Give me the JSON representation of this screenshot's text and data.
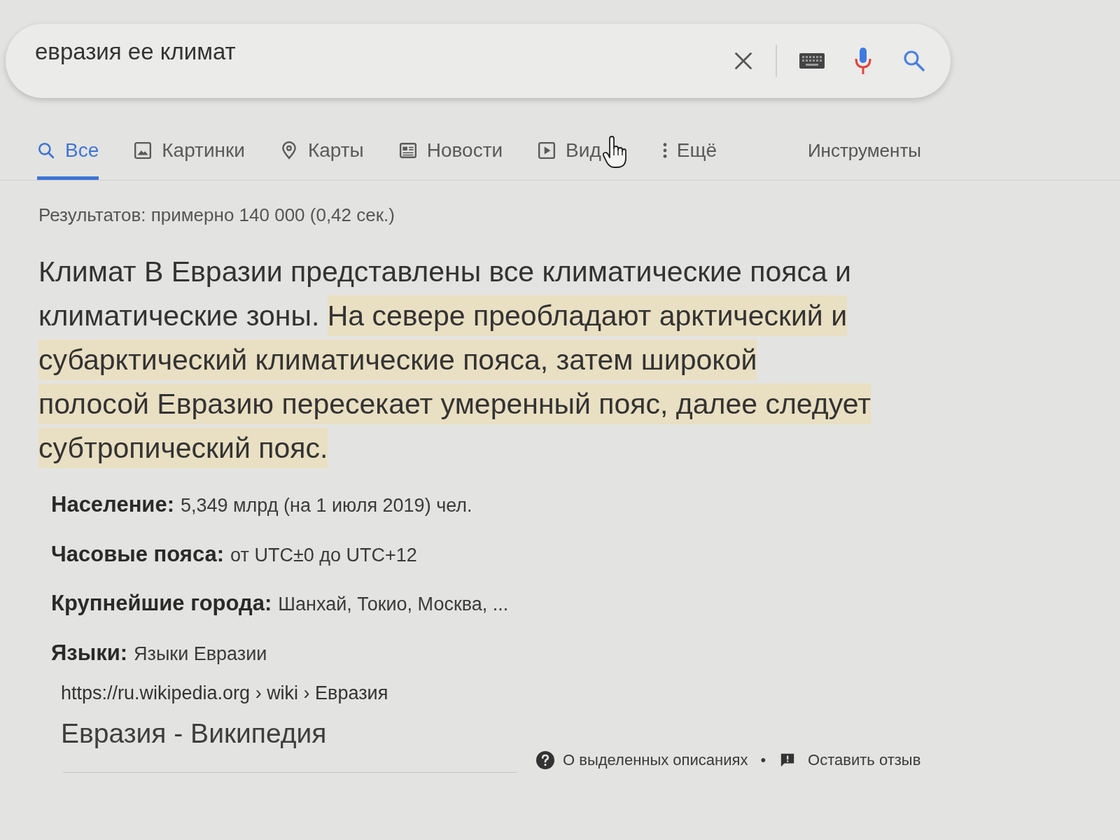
{
  "search": {
    "value": "евразия ее климат"
  },
  "tabs": [
    {
      "kind": "all",
      "label": "Все",
      "selected": true
    },
    {
      "kind": "images",
      "label": "Картинки",
      "selected": false
    },
    {
      "kind": "maps",
      "label": "Карты",
      "selected": false
    },
    {
      "kind": "news",
      "label": "Новости",
      "selected": false
    },
    {
      "kind": "video",
      "label": "Вид",
      "selected": false
    },
    {
      "kind": "more",
      "label": "Ещё",
      "selected": false
    }
  ],
  "tools": "Инструменты",
  "result_stats": "Результатов: примерно 140 000 (0,42 сек.)",
  "featured_snippet": {
    "segments": [
      {
        "text": "Климат В Евразии представлены все климатические пояса и климатические зоны. ",
        "highlighted": false
      },
      {
        "text": "На севере преобладают арктический и субарктический климатические пояса, затем широкой полосой Евразию пересекает умеренный пояс, далее следует субтропический пояс.",
        "highlighted": true
      }
    ],
    "facts": [
      {
        "label": "Население:",
        "value": "5,349 млрд (на 1 июля 2019) чел."
      },
      {
        "label": "Часовые пояса:",
        "value": "от UTC±0 до UTC+12"
      },
      {
        "label": "Крупнейшие города:",
        "value": "Шанхай, Токио, Москва, ..."
      },
      {
        "label": "Языки:",
        "value": "Языки Евразии"
      }
    ],
    "source_url": "https://ru.wikipedia.org › wiki › Евразия",
    "source_title": "Евразия - Википедия"
  },
  "footer": {
    "about": "О выделенных описаниях",
    "separator": "•",
    "feedback": "Оставить отзыв"
  }
}
